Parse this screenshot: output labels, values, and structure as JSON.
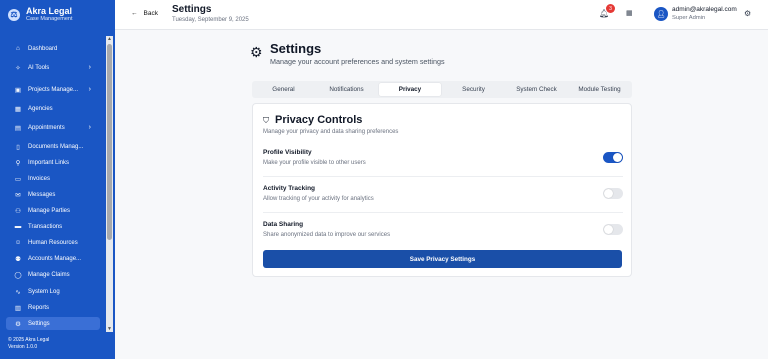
{
  "brand": {
    "name": "Akra Legal",
    "subtitle": "Case Management",
    "logo_icon": "scales-icon"
  },
  "sidebar": {
    "items": [
      {
        "label": "Dashboard",
        "icon": "home-icon",
        "glyph": "⌂",
        "has_chevron": false
      },
      {
        "label": "AI Tools",
        "icon": "sparkle-icon",
        "glyph": "✧",
        "has_chevron": true
      },
      {
        "label": "Projects Manage...",
        "icon": "briefcase-icon",
        "glyph": "▣",
        "has_chevron": true
      },
      {
        "label": "Agencies",
        "icon": "building-icon",
        "glyph": "▦",
        "has_chevron": false
      },
      {
        "label": "Appointments",
        "icon": "calendar-icon",
        "glyph": "▤",
        "has_chevron": true
      },
      {
        "label": "Documents Manag...",
        "icon": "document-icon",
        "glyph": "▯",
        "has_chevron": false
      },
      {
        "label": "Important Links",
        "icon": "link-icon",
        "glyph": "⚲",
        "has_chevron": false
      },
      {
        "label": "Invoices",
        "icon": "invoice-icon",
        "glyph": "▭",
        "has_chevron": false
      },
      {
        "label": "Messages",
        "icon": "message-icon",
        "glyph": "✉",
        "has_chevron": false
      },
      {
        "label": "Manage Parties",
        "icon": "users-icon",
        "glyph": "⚇",
        "has_chevron": false
      },
      {
        "label": "Transactions",
        "icon": "card-icon",
        "glyph": "▬",
        "has_chevron": false
      },
      {
        "label": "Human Resources",
        "icon": "person-icon",
        "glyph": "☺",
        "has_chevron": false
      },
      {
        "label": "Accounts Manage...",
        "icon": "user-group-icon",
        "glyph": "⚉",
        "has_chevron": false
      },
      {
        "label": "Manage Claims",
        "icon": "claim-icon",
        "glyph": "◯",
        "has_chevron": false
      },
      {
        "label": "System Log",
        "icon": "activity-icon",
        "glyph": "∿",
        "has_chevron": false
      },
      {
        "label": "Reports",
        "icon": "chart-icon",
        "glyph": "▥",
        "has_chevron": false
      },
      {
        "label": "Settings",
        "icon": "gear-icon",
        "glyph": "⚙",
        "has_chevron": false,
        "active": true
      }
    ],
    "footer": {
      "copyright": "© 2025 Akra Legal",
      "version": "Version 1.0.0"
    }
  },
  "header": {
    "back_label": "Back",
    "title": "Settings",
    "date": "Tuesday, September 9, 2025",
    "notification_count": "3",
    "user_email": "admin@akralegal.com",
    "user_role": "Super Admin"
  },
  "page": {
    "title": "Settings",
    "subtitle": "Manage your account preferences and system settings",
    "tabs": [
      "General",
      "Notifications",
      "Privacy",
      "Security",
      "System Check",
      "Module Testing"
    ],
    "active_tab": "Privacy"
  },
  "privacy": {
    "title": "Privacy Controls",
    "subtitle": "Manage your privacy and data sharing preferences",
    "settings": [
      {
        "label": "Profile Visibility",
        "description": "Make your profile visible to other users",
        "enabled": true
      },
      {
        "label": "Activity Tracking",
        "description": "Allow tracking of your activity for analytics",
        "enabled": false
      },
      {
        "label": "Data Sharing",
        "description": "Share anonymized data to improve our services",
        "enabled": false
      }
    ],
    "save_label": "Save Privacy Settings"
  },
  "colors": {
    "sidebar": "#1a56c4",
    "accent": "#1a4fa8",
    "badge": "#e53935"
  }
}
